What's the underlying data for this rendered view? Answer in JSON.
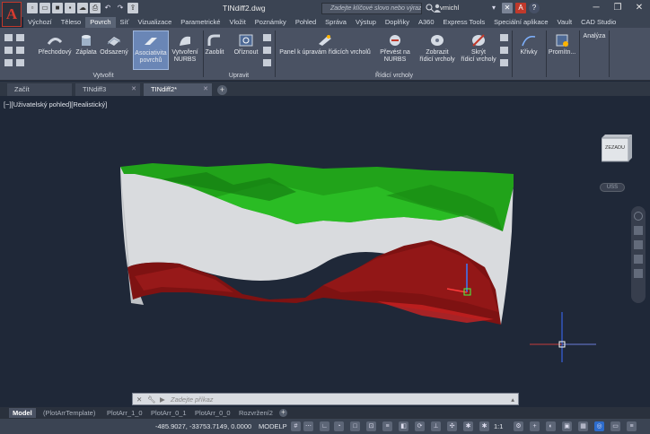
{
  "app": {
    "logo": "A",
    "window_title": "TINdiff2.dwg",
    "search_placeholder": "Zadejte klíčové slovo nebo výraz",
    "user": "vmichl"
  },
  "menu": [
    "Výchozí",
    "Těleso",
    "Povrch",
    "Síť",
    "Vizualizace",
    "Parametrické",
    "Vložit",
    "Poznámky",
    "Pohled",
    "Správa",
    "Výstup",
    "Doplňky",
    "A360",
    "Express Tools",
    "Speciální aplikace",
    "Vault",
    "CAD Studio"
  ],
  "active_menu": "Povrch",
  "ribbon": {
    "buttons": {
      "prechodovy": "Přechodový",
      "zaplata": "Záplata",
      "odsazeny": "Odsazený",
      "asoc1": "Asociativita",
      "asoc2": "povrchů",
      "nurbs1": "Vytvoření",
      "nurbs2": "NURBS",
      "zaoblit": "Zaoblit",
      "oriznout": "Oříznout",
      "panel": "Panel k úpravám řídicích vrcholů",
      "prevest1": "Převést na",
      "prevest2": "NURBS",
      "zobrazit1": "Zobrazit",
      "zobrazit2": "řídicí vrcholy",
      "skryt1": "Skrýt",
      "skryt2": "řídicí vrcholy",
      "krivky": "Křivky",
      "promitn": "Promítn...",
      "analyza": "Analýza"
    },
    "groups": {
      "vytvorit": "Vytvořit",
      "upravit": "Upravit",
      "ridici": "Řídicí vrcholy"
    }
  },
  "file_tabs": [
    {
      "label": "Začít"
    },
    {
      "label": "TINdiff3"
    },
    {
      "label": "TINdiff2*"
    }
  ],
  "viewport_label": "[−][Uživatelský pohled][Realistický]",
  "viewcube_label": "ZEZADU",
  "wcs_label": "USS",
  "command_placeholder": "Zadejte příkaz",
  "layout_tabs": [
    "Model",
    "(PlotArrTemplate)",
    "PlotArr_1_0",
    "PlotArr_0_1",
    "PlotArr_0_0",
    "Rozvržení2"
  ],
  "status": {
    "coords": "-485.9027, -33753.7149, 0.0000",
    "space": "MODELP",
    "scale": "1:1"
  },
  "colors": {
    "surface_top": "#22a51c",
    "surface_mid": "#e4e6e8",
    "surface_bottom": "#8c1515",
    "bg": "#1f2838"
  }
}
